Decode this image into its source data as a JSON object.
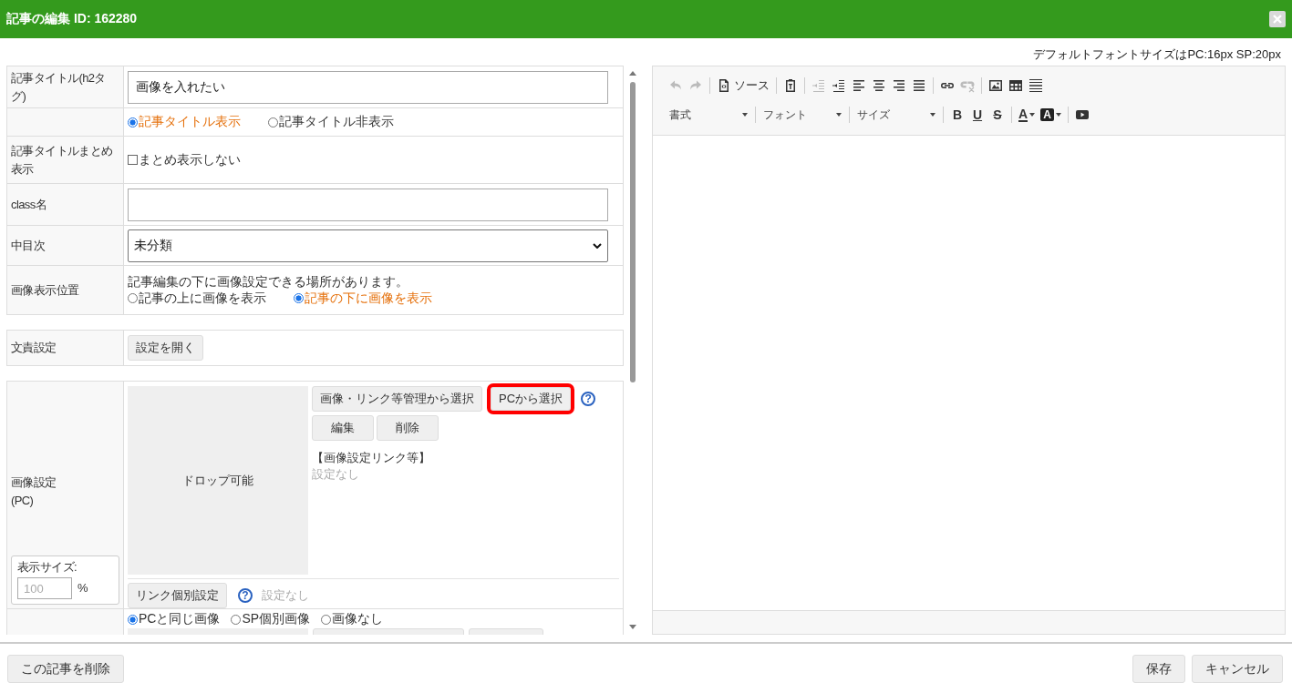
{
  "window": {
    "title": "記事の編集 ID: 162280"
  },
  "font_note": "デフォルトフォントサイズはPC:16px SP:20px",
  "form": {
    "rows": [
      {
        "kind": "text",
        "label": "記事タイトル(h2タグ)",
        "value": "画像を入れたい"
      },
      {
        "kind": "radio",
        "options": [
          {
            "label": "記事タイトル表示",
            "selected": true
          },
          {
            "label": "記事タイトル非表示",
            "selected": false
          }
        ]
      },
      {
        "kind": "checkbox",
        "label": "記事タイトルまとめ表示",
        "option": {
          "label": "まとめ表示しない",
          "checked": false
        }
      },
      {
        "kind": "text",
        "label": "class名"
      },
      {
        "kind": "select",
        "label": "中目次",
        "value": "未分類"
      },
      {
        "kind": "radio",
        "label": "画像表示位置",
        "note": "記事編集の下に画像設定できる場所があります。",
        "options": [
          {
            "label": "記事の上に画像を表示",
            "selected": false
          },
          {
            "label": "記事の下に画像を表示",
            "selected": true
          }
        ]
      }
    ]
  },
  "authorship": {
    "label": "文責設定",
    "button": "設定を開く"
  },
  "image_pc": {
    "label_lines": [
      "画像設定",
      "(PC)"
    ],
    "size_label": "表示サイズ:",
    "size_placeholder": "100",
    "size_unit": "%",
    "drop_text": "ドロップ可能",
    "select_buttons": [
      {
        "label": "画像・リンク等管理から選択",
        "highlighted": false
      },
      {
        "label": "PCから選択",
        "highlighted": true
      }
    ],
    "help": "?",
    "edit_buttons": [
      "編集",
      "削除"
    ],
    "link_heading": "【画像設定リンク等】",
    "link_value": "設定なし",
    "link_button": "リンク個別設定",
    "link_help": "?",
    "link_status": "設定なし"
  },
  "image_sp": {
    "options": [
      {
        "label": "PCと同じ画像",
        "selected": true
      },
      {
        "label": "SP個別画像",
        "selected": false
      },
      {
        "label": "画像なし",
        "selected": false
      }
    ]
  },
  "editor": {
    "toolbar": [
      [
        [
          {
            "kind": "undo",
            "disabled": true
          },
          {
            "kind": "redo",
            "disabled": true
          }
        ],
        [
          {
            "kind": "source",
            "label": "ソース",
            "disabled": false
          }
        ],
        [
          {
            "kind": "paste",
            "disabled": false
          }
        ],
        [
          {
            "kind": "outdent",
            "disabled": true
          },
          {
            "kind": "indent",
            "disabled": false
          },
          {
            "kind": "align-left",
            "disabled": false
          },
          {
            "kind": "align-center",
            "disabled": false
          },
          {
            "kind": "align-right",
            "disabled": false
          },
          {
            "kind": "justify",
            "disabled": false
          }
        ],
        [
          {
            "kind": "link",
            "disabled": false
          },
          {
            "kind": "unlink",
            "disabled": true
          }
        ],
        [
          {
            "kind": "image",
            "disabled": false
          },
          {
            "kind": "table",
            "disabled": false
          },
          {
            "kind": "hr",
            "disabled": false
          }
        ]
      ],
      [
        [
          {
            "kind": "dropdown",
            "label": "書式",
            "disabled": false
          }
        ],
        [
          {
            "kind": "dropdown",
            "label": "フォント",
            "disabled": false
          }
        ],
        [
          {
            "kind": "dropdown",
            "label": "サイズ",
            "disabled": false
          }
        ],
        [
          {
            "kind": "bold",
            "label": "B",
            "disabled": false
          },
          {
            "kind": "underline",
            "label": "U",
            "disabled": false
          },
          {
            "kind": "strike",
            "label": "S",
            "disabled": false
          }
        ],
        [
          {
            "kind": "textcolor",
            "label": "A",
            "disabled": false
          },
          {
            "kind": "bgcolor",
            "label": "A",
            "disabled": false
          }
        ],
        [
          {
            "kind": "video",
            "disabled": false
          }
        ]
      ]
    ]
  },
  "footer": {
    "delete": "この記事を削除",
    "save": "保存",
    "cancel": "キャンセル"
  }
}
